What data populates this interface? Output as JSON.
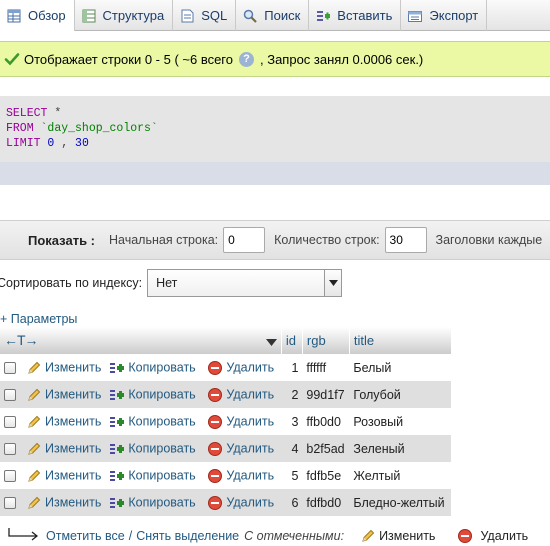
{
  "tabs": [
    {
      "label": "Обзор",
      "icon": "browse-icon",
      "active": true
    },
    {
      "label": "Структура",
      "icon": "structure-icon",
      "active": false
    },
    {
      "label": "SQL",
      "icon": "sql-icon",
      "active": false
    },
    {
      "label": "Поиск",
      "icon": "search-icon",
      "active": false
    },
    {
      "label": "Вставить",
      "icon": "insert-icon",
      "active": false
    },
    {
      "label": "Экспорт",
      "icon": "export-icon",
      "active": false
    }
  ],
  "message": {
    "text_before": "Отображает строки 0 - 5 ( ~6 всего",
    "help": "?",
    "text_after": ", Запрос занял 0.0006 сек.)"
  },
  "sql": {
    "select": "SELECT",
    "star": "*",
    "from": "FROM",
    "table": "`day_shop_colors`",
    "limit": "LIMIT",
    "offset": "0",
    "comma": ",",
    "count": "30"
  },
  "nav": {
    "show_label": "Показать :",
    "start_label": "Начальная строка:",
    "start_value": "0",
    "count_label": "Количество строк:",
    "count_value": "30",
    "headers_label": "Заголовки каждые"
  },
  "sort": {
    "label": "Сортировать по индексу:",
    "value": "Нет"
  },
  "params_label": "+ Параметры",
  "table": {
    "arrows": "←T→",
    "columns": [
      "id",
      "rgb",
      "title"
    ],
    "edit_label": "Изменить",
    "copy_label": "Копировать",
    "delete_label": "Удалить",
    "rows": [
      {
        "id": "1",
        "rgb": "ffffff",
        "title": "Белый"
      },
      {
        "id": "2",
        "rgb": "99d1f7",
        "title": "Голубой"
      },
      {
        "id": "3",
        "rgb": "ffb0d0",
        "title": "Розовый"
      },
      {
        "id": "4",
        "rgb": "b2f5ad",
        "title": "Зеленый"
      },
      {
        "id": "5",
        "rgb": "fdfb5e",
        "title": "Желтый"
      },
      {
        "id": "6",
        "rgb": "fdfbd0",
        "title": "Бледно-желтый"
      }
    ]
  },
  "bottom": {
    "check_all": "Отметить все",
    "separator": "/",
    "uncheck_all": "Снять выделение",
    "with_selected": "С отмеченными:",
    "edit": "Изменить",
    "delete": "Удалить"
  },
  "colors": {
    "success_bg": "#ebf8a4",
    "link": "#235a81",
    "sql_keyword": "#990099",
    "sql_string": "#008000",
    "sql_number": "#0000c0"
  }
}
